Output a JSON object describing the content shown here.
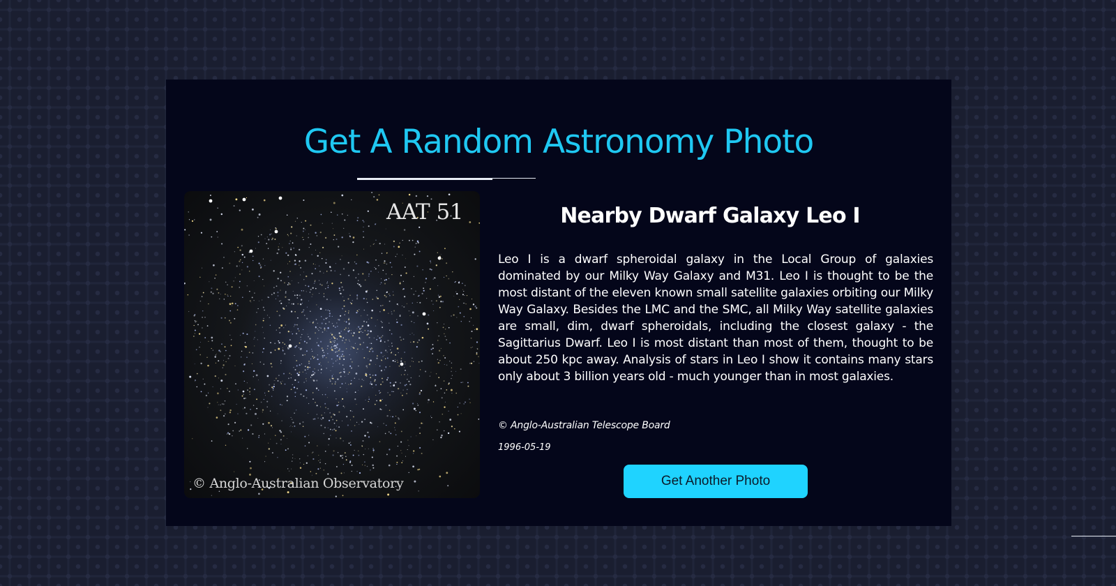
{
  "page": {
    "title": "Get A Random Astronomy Photo"
  },
  "photo": {
    "overlay_top_right": "AAT 51",
    "overlay_bottom_left": "© Anglo-Australian Observatory",
    "title": "Nearby Dwarf Galaxy Leo I",
    "description": "Leo I is a dwarf spheroidal galaxy in the Local Group of galaxies dominated by our Milky Way Galaxy and M31. Leo I is thought to be the most distant of the eleven known small satellite galaxies orbiting our Milky Way Galaxy. Besides the LMC and the SMC, all Milky Way satellite galaxies are small, dim, dwarf spheroidals, including the closest galaxy - the Sagittarius Dwarf. Leo I is most distant than most of them, thought to be about 250 kpc away. Analysis of stars in Leo I show it contains many stars only about 3 billion years old - much younger than in most galaxies.",
    "copyright": "© Anglo-Australian Telescope Board",
    "date": "1996-05-19"
  },
  "actions": {
    "another_label": "Get Another Photo"
  },
  "colors": {
    "accent": "#1fc8f2",
    "button": "#1fd3ff",
    "panel": "#04061a",
    "background": "#1a1e30"
  }
}
